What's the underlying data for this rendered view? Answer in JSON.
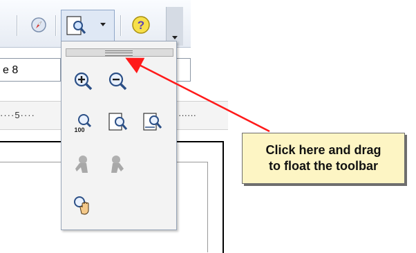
{
  "toolbar": {
    "buttons": [
      {
        "name": "navigator-icon",
        "label": ""
      },
      {
        "name": "zoom-dropdown-icon",
        "label": ""
      },
      {
        "name": "help-icon",
        "label": "?"
      }
    ]
  },
  "font_size_field": {
    "value": "e 8"
  },
  "ruler": {
    "left_text": "····5····",
    "right_text": "······"
  },
  "zoom_popup": {
    "rows": [
      [
        "zoom-in-icon",
        "zoom-out-icon"
      ],
      [
        "zoom-100-icon",
        "zoom-whole-page-icon",
        "zoom-page-width-icon"
      ],
      [
        "zoom-previous-icon",
        "zoom-next-icon"
      ],
      [
        "pan-hand-icon"
      ]
    ],
    "zoom_100_label": "100"
  },
  "callout": {
    "line1": "Click here and drag",
    "line2": "to float the toolbar"
  },
  "colors": {
    "arrow": "#ff1a1a",
    "callout_bg": "#fdf5c4",
    "help_bg": "#f7e04a"
  }
}
